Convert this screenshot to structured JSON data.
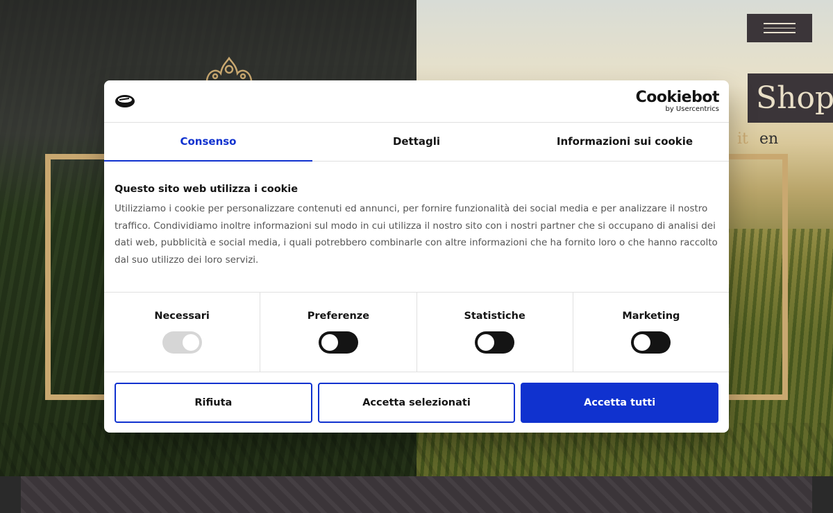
{
  "site": {
    "menu_icon": "hamburger-icon",
    "shop_label": "Shop",
    "languages": [
      "it",
      "en"
    ],
    "accent_color": "#c9a870"
  },
  "dialog": {
    "provider_logo": "Cookiebot",
    "provider_sub": "by Usercentrics",
    "tabs": [
      "Consenso",
      "Dettagli",
      "Informazioni sui cookie"
    ],
    "active_tab": 0,
    "title": "Questo sito web utilizza i cookie",
    "description": "Utilizziamo i cookie per personalizzare contenuti ed annunci, per fornire funzionalità dei social media e per analizzare il nostro traffico. Condividiamo inoltre informazioni sul modo in cui utilizza il nostro sito con i nostri partner che si occupano di analisi dei dati web, pubblicità e social media, i quali potrebbero combinarle con altre informazioni che ha fornito loro o che hanno raccolto dal suo utilizzo dei loro servizi.",
    "categories": [
      {
        "label": "Necessari",
        "enabled": true,
        "locked": true
      },
      {
        "label": "Preferenze",
        "enabled": false,
        "locked": false
      },
      {
        "label": "Statistiche",
        "enabled": false,
        "locked": false
      },
      {
        "label": "Marketing",
        "enabled": false,
        "locked": false
      }
    ],
    "buttons": {
      "reject": "Rifiuta",
      "accept_selected": "Accetta selezionati",
      "accept_all": "Accetta tutti"
    },
    "brand_color": "#1032cf"
  }
}
